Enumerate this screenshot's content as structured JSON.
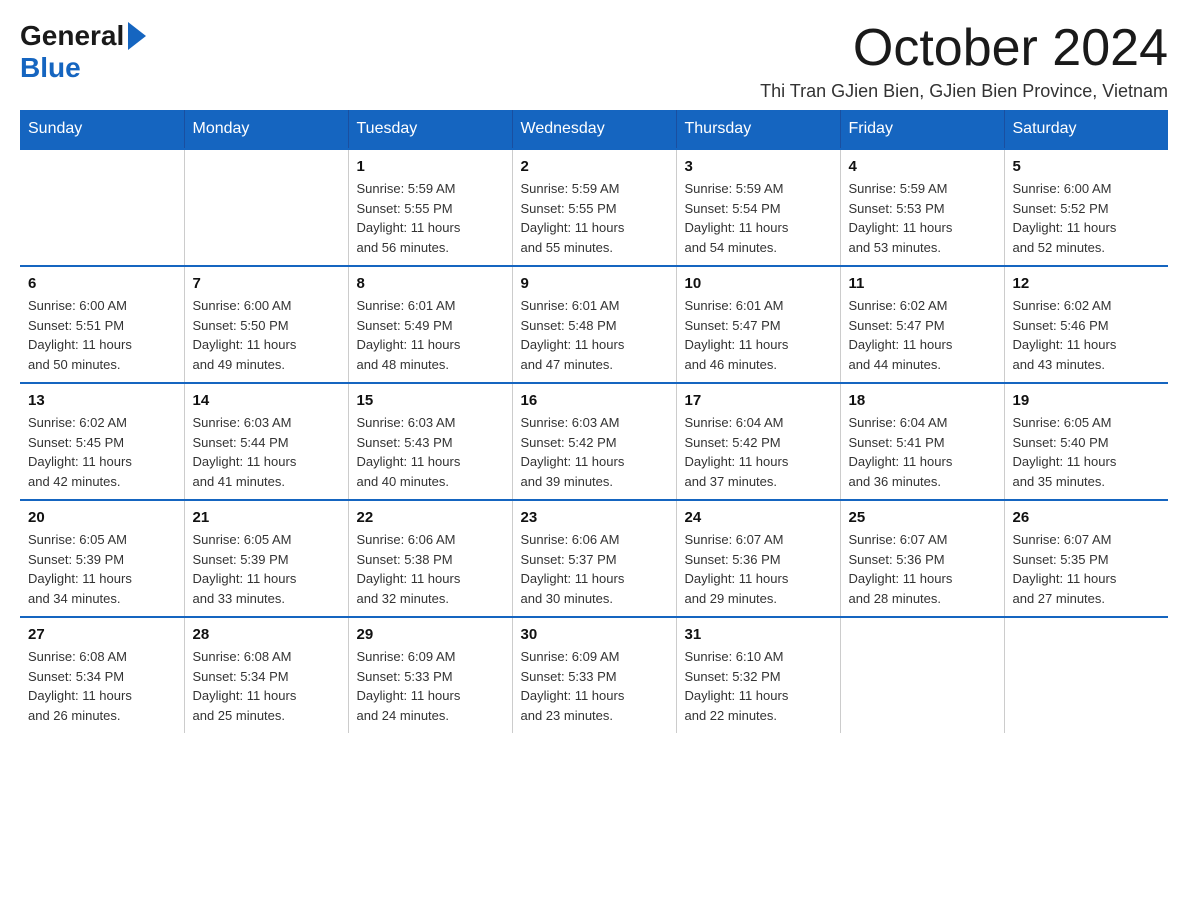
{
  "logo": {
    "general": "General",
    "blue": "Blue"
  },
  "title": "October 2024",
  "subtitle": "Thi Tran GJien Bien, GJien Bien Province, Vietnam",
  "days_of_week": [
    "Sunday",
    "Monday",
    "Tuesday",
    "Wednesday",
    "Thursday",
    "Friday",
    "Saturday"
  ],
  "weeks": [
    [
      {
        "day": "",
        "info": ""
      },
      {
        "day": "",
        "info": ""
      },
      {
        "day": "1",
        "info": "Sunrise: 5:59 AM\nSunset: 5:55 PM\nDaylight: 11 hours\nand 56 minutes."
      },
      {
        "day": "2",
        "info": "Sunrise: 5:59 AM\nSunset: 5:55 PM\nDaylight: 11 hours\nand 55 minutes."
      },
      {
        "day": "3",
        "info": "Sunrise: 5:59 AM\nSunset: 5:54 PM\nDaylight: 11 hours\nand 54 minutes."
      },
      {
        "day": "4",
        "info": "Sunrise: 5:59 AM\nSunset: 5:53 PM\nDaylight: 11 hours\nand 53 minutes."
      },
      {
        "day": "5",
        "info": "Sunrise: 6:00 AM\nSunset: 5:52 PM\nDaylight: 11 hours\nand 52 minutes."
      }
    ],
    [
      {
        "day": "6",
        "info": "Sunrise: 6:00 AM\nSunset: 5:51 PM\nDaylight: 11 hours\nand 50 minutes."
      },
      {
        "day": "7",
        "info": "Sunrise: 6:00 AM\nSunset: 5:50 PM\nDaylight: 11 hours\nand 49 minutes."
      },
      {
        "day": "8",
        "info": "Sunrise: 6:01 AM\nSunset: 5:49 PM\nDaylight: 11 hours\nand 48 minutes."
      },
      {
        "day": "9",
        "info": "Sunrise: 6:01 AM\nSunset: 5:48 PM\nDaylight: 11 hours\nand 47 minutes."
      },
      {
        "day": "10",
        "info": "Sunrise: 6:01 AM\nSunset: 5:47 PM\nDaylight: 11 hours\nand 46 minutes."
      },
      {
        "day": "11",
        "info": "Sunrise: 6:02 AM\nSunset: 5:47 PM\nDaylight: 11 hours\nand 44 minutes."
      },
      {
        "day": "12",
        "info": "Sunrise: 6:02 AM\nSunset: 5:46 PM\nDaylight: 11 hours\nand 43 minutes."
      }
    ],
    [
      {
        "day": "13",
        "info": "Sunrise: 6:02 AM\nSunset: 5:45 PM\nDaylight: 11 hours\nand 42 minutes."
      },
      {
        "day": "14",
        "info": "Sunrise: 6:03 AM\nSunset: 5:44 PM\nDaylight: 11 hours\nand 41 minutes."
      },
      {
        "day": "15",
        "info": "Sunrise: 6:03 AM\nSunset: 5:43 PM\nDaylight: 11 hours\nand 40 minutes."
      },
      {
        "day": "16",
        "info": "Sunrise: 6:03 AM\nSunset: 5:42 PM\nDaylight: 11 hours\nand 39 minutes."
      },
      {
        "day": "17",
        "info": "Sunrise: 6:04 AM\nSunset: 5:42 PM\nDaylight: 11 hours\nand 37 minutes."
      },
      {
        "day": "18",
        "info": "Sunrise: 6:04 AM\nSunset: 5:41 PM\nDaylight: 11 hours\nand 36 minutes."
      },
      {
        "day": "19",
        "info": "Sunrise: 6:05 AM\nSunset: 5:40 PM\nDaylight: 11 hours\nand 35 minutes."
      }
    ],
    [
      {
        "day": "20",
        "info": "Sunrise: 6:05 AM\nSunset: 5:39 PM\nDaylight: 11 hours\nand 34 minutes."
      },
      {
        "day": "21",
        "info": "Sunrise: 6:05 AM\nSunset: 5:39 PM\nDaylight: 11 hours\nand 33 minutes."
      },
      {
        "day": "22",
        "info": "Sunrise: 6:06 AM\nSunset: 5:38 PM\nDaylight: 11 hours\nand 32 minutes."
      },
      {
        "day": "23",
        "info": "Sunrise: 6:06 AM\nSunset: 5:37 PM\nDaylight: 11 hours\nand 30 minutes."
      },
      {
        "day": "24",
        "info": "Sunrise: 6:07 AM\nSunset: 5:36 PM\nDaylight: 11 hours\nand 29 minutes."
      },
      {
        "day": "25",
        "info": "Sunrise: 6:07 AM\nSunset: 5:36 PM\nDaylight: 11 hours\nand 28 minutes."
      },
      {
        "day": "26",
        "info": "Sunrise: 6:07 AM\nSunset: 5:35 PM\nDaylight: 11 hours\nand 27 minutes."
      }
    ],
    [
      {
        "day": "27",
        "info": "Sunrise: 6:08 AM\nSunset: 5:34 PM\nDaylight: 11 hours\nand 26 minutes."
      },
      {
        "day": "28",
        "info": "Sunrise: 6:08 AM\nSunset: 5:34 PM\nDaylight: 11 hours\nand 25 minutes."
      },
      {
        "day": "29",
        "info": "Sunrise: 6:09 AM\nSunset: 5:33 PM\nDaylight: 11 hours\nand 24 minutes."
      },
      {
        "day": "30",
        "info": "Sunrise: 6:09 AM\nSunset: 5:33 PM\nDaylight: 11 hours\nand 23 minutes."
      },
      {
        "day": "31",
        "info": "Sunrise: 6:10 AM\nSunset: 5:32 PM\nDaylight: 11 hours\nand 22 minutes."
      },
      {
        "day": "",
        "info": ""
      },
      {
        "day": "",
        "info": ""
      }
    ]
  ]
}
